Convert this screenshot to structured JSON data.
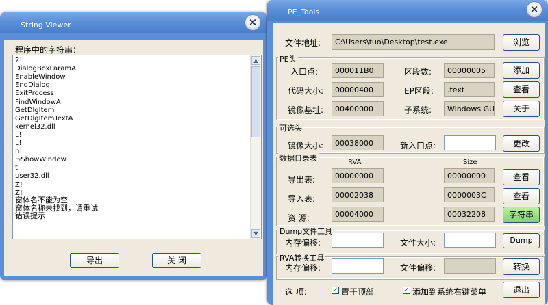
{
  "string_viewer": {
    "title": "String Viewer",
    "list_label": "程序中的字符串：",
    "strings": [
      "2!",
      "DialogBoxParamA",
      "EnableWindow",
      "EndDialog",
      "ExitProcess",
      "FindWindowA",
      "GetDlgItem",
      "GetDlgItemTextA",
      "kernel32.dll",
      "L!",
      "L!",
      "n!",
      "¬ShowWindow",
      "t",
      "user32.dll",
      "Z!",
      "Z!",
      "窗体名不能为空",
      "窗体名称未找到，请重试",
      "错误提示"
    ],
    "export_button": "导出",
    "close_button": "关 闭",
    "close_icon": "⨯"
  },
  "pe_tools": {
    "title": "PE_Tools",
    "close_icon": "⨯",
    "file_label": "文件地址:",
    "file_path": "C:\\Users\\tuo\\Desktop\\test.exe",
    "browse_button": "浏览",
    "pe_header": {
      "title": "PE头",
      "entry_label": "入口点:",
      "entry_value": "000011B0",
      "sections_label": "区段数:",
      "sections_value": "00000005",
      "code_size_label": "代码大小:",
      "code_size_value": "00000400",
      "ep_section_label": "EP区段:",
      "ep_section_value": ".text",
      "image_base_label": "镜像基址:",
      "image_base_value": "00400000",
      "subsystem_label": "子系统:",
      "subsystem_value": "Windows GUI",
      "add_button": "添加",
      "view_button": "查看",
      "about_button": "关于"
    },
    "optional_header": {
      "title": "可选头",
      "image_size_label": "镜像大小:",
      "image_size_value": "00038000",
      "new_entry_label": "新入口点:",
      "new_entry_value": "",
      "change_button": "更改"
    },
    "data_directory": {
      "title": "数据目录表",
      "rva_header": "RVA",
      "size_header": "Size",
      "export_label": "导出表:",
      "export_rva": "00000000",
      "export_size": "00000000",
      "export_view_button": "查看",
      "import_label": "导入表:",
      "import_rva": "00002038",
      "import_size": "0000003C",
      "import_view_button": "查看",
      "resource_label": "资 源:",
      "resource_rva": "00004000",
      "resource_size": "00032208",
      "strings_button": "字符串"
    },
    "dump_tool": {
      "title": "Dump文件工具",
      "mem_offset_label": "内存偏移:",
      "mem_offset_value": "",
      "file_size_label": "文件大小:",
      "file_size_value": "",
      "dump_button": "Dump"
    },
    "rva_tool": {
      "title": "RVA转换工具",
      "mem_offset_label": "内存偏移:",
      "mem_offset_value": "",
      "file_offset_label": "文件偏移:",
      "file_offset_value": "",
      "convert_button": "转换"
    },
    "options": {
      "label": "选 项:",
      "topmost_label": "置于顶部",
      "topmost_checked": "✓",
      "context_menu_label": "添加到系统右键菜单",
      "context_menu_checked": "✓",
      "exit_button": "退出"
    }
  }
}
